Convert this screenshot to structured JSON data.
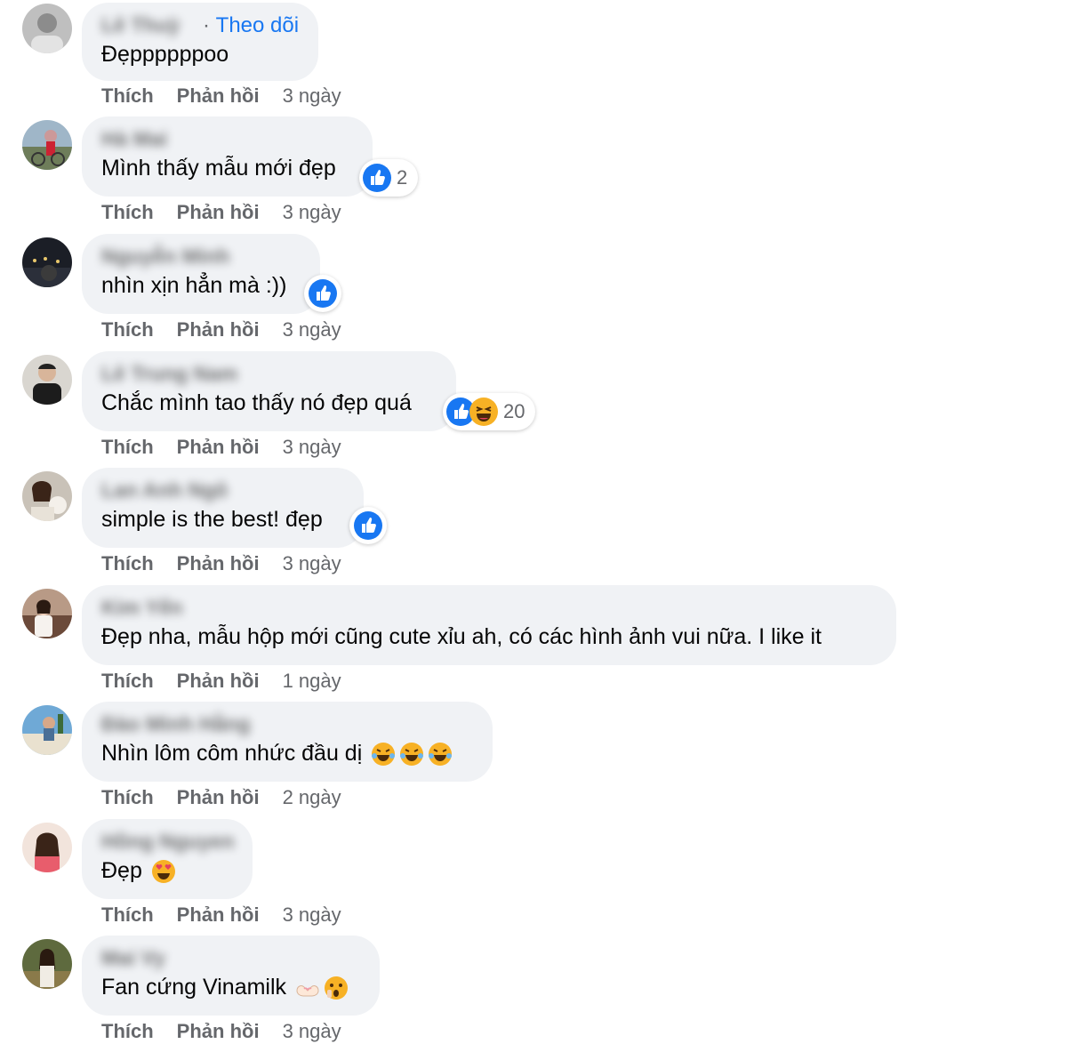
{
  "comments": [
    {
      "name": "Lê Thuỳ",
      "follow": "Theo dõi",
      "follow_sep": "·",
      "text": "Đẹppppppoo",
      "like": "Thích",
      "reply": "Phản hồi",
      "time": "3 ngày"
    },
    {
      "name": "Hà Mai",
      "text": "Mình thấy mẫu mới đẹp",
      "reaction_count": "2",
      "like": "Thích",
      "reply": "Phản hồi",
      "time": "3 ngày"
    },
    {
      "name": "Nguyễn Minh",
      "text": "nhìn xịn hẳn mà :))",
      "like": "Thích",
      "reply": "Phản hồi",
      "time": "3 ngày"
    },
    {
      "name": "Lê Trung Nam",
      "text": "Chắc mình tao thấy nó đẹp quá",
      "reaction_count": "20",
      "like": "Thích",
      "reply": "Phản hồi",
      "time": "3 ngày"
    },
    {
      "name": "Lan Anh Ngô",
      "text": "simple is the best! đẹp",
      "like": "Thích",
      "reply": "Phản hồi",
      "time": "3 ngày"
    },
    {
      "name": "Kim Yến",
      "text": "Đẹp nha, mẫu hộp mới cũng cute xỉu ah, có các hình ảnh vui nữa. I like it",
      "like": "Thích",
      "reply": "Phản hồi",
      "time": "1 ngày"
    },
    {
      "name": "Đào Minh Hằng",
      "text": "Nhìn lôm côm nhức đầu dị",
      "like": "Thích",
      "reply": "Phản hồi",
      "time": "2 ngày"
    },
    {
      "name": "Hồng Nguyen",
      "text": "Đẹp",
      "like": "Thích",
      "reply": "Phản hồi",
      "time": "3 ngày"
    },
    {
      "name": "Mai Vy",
      "text": "Fan cứng Vinamilk",
      "like": "Thích",
      "reply": "Phản hồi",
      "time": "3 ngày"
    }
  ],
  "colors": {
    "bubble": "#f0f2f5",
    "link": "#1877f2",
    "muted": "#65676b",
    "like_blue": "#1877f2",
    "haha_yellow": "#f7b125"
  }
}
